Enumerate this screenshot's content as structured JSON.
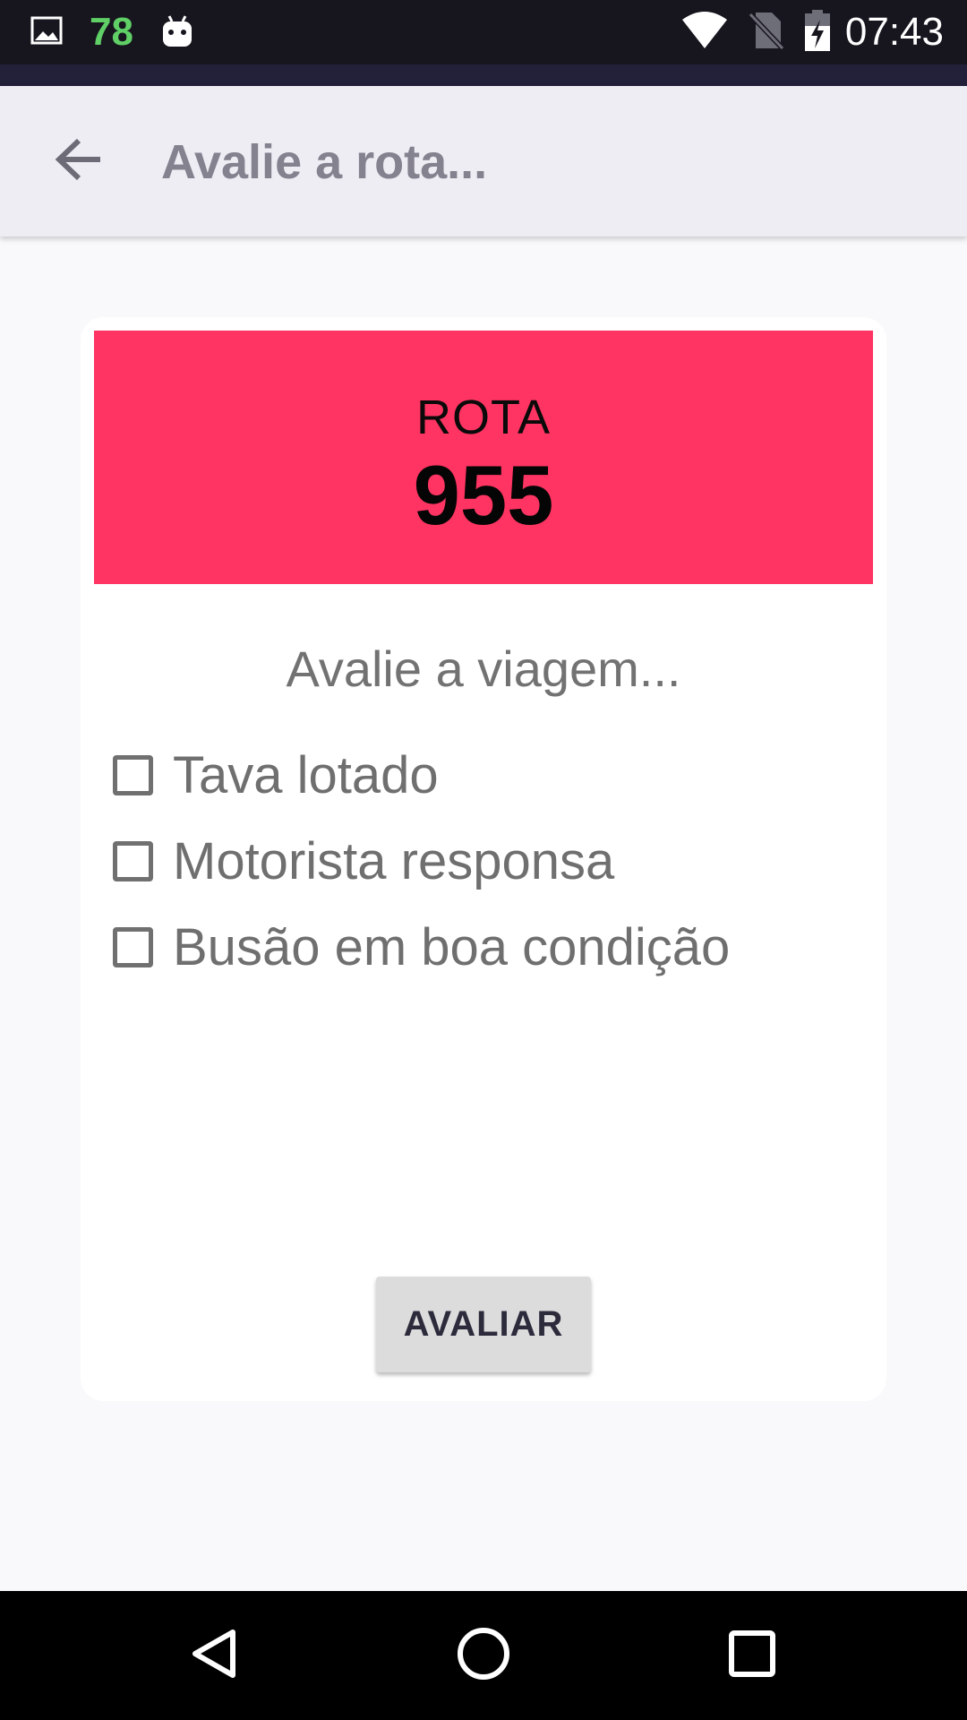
{
  "status_bar": {
    "notification_count": "78",
    "time": "07:43",
    "icons": [
      "image-icon",
      "android-icon",
      "wifi-icon",
      "no-sim-icon",
      "battery-charging-icon"
    ]
  },
  "app_bar": {
    "title": "Avalie a rota...",
    "back_icon": "arrow-back-icon"
  },
  "route": {
    "label": "ROTA",
    "number": "955",
    "header_color": "#ff3462"
  },
  "evaluation": {
    "prompt": "Avalie a viagem...",
    "options": [
      {
        "label": "Tava lotado",
        "checked": false
      },
      {
        "label": "Motorista responsa",
        "checked": false
      },
      {
        "label": "Busão em boa condição",
        "checked": false
      }
    ],
    "submit_label": "AVALIAR"
  },
  "nav_bar": {
    "icons": [
      "back-triangle-icon",
      "home-circle-icon",
      "recents-square-icon"
    ]
  }
}
